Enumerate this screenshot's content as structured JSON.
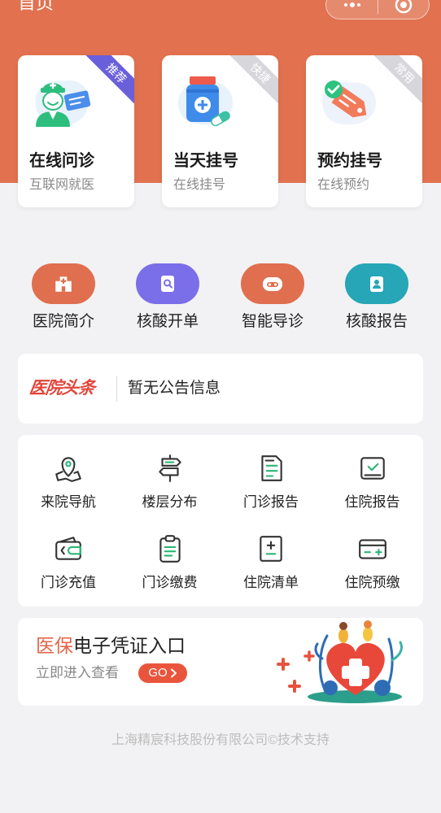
{
  "header": {
    "title": "首页",
    "background_color": "#E1714F",
    "capsule": {
      "more_icon": "more-dots-icon",
      "record_icon": "target-icon"
    }
  },
  "quick_cards": [
    {
      "title": "在线问诊",
      "subtitle": "互联网就医",
      "tag": "推荐",
      "tag_color": "#6A5FDB",
      "icon": "doctor-icon"
    },
    {
      "title": "当天挂号",
      "subtitle": "在线挂号",
      "tag": "快捷",
      "tag_color": "#D6D6DB",
      "icon": "medicine-bottle-icon"
    },
    {
      "title": "预约挂号",
      "subtitle": "在线预约",
      "tag": "常用",
      "tag_color": "#D6D6DB",
      "icon": "appointment-tag-icon"
    }
  ],
  "shortcuts": [
    {
      "label": "医院简介",
      "icon": "hospital-icon",
      "color": "#DF6F4E"
    },
    {
      "label": "核酸开单",
      "icon": "document-search-icon",
      "color": "#7A6EE9"
    },
    {
      "label": "智能导诊",
      "icon": "robot-icon",
      "color": "#DF6F4E"
    },
    {
      "label": "核酸报告",
      "icon": "report-badge-icon",
      "color": "#26A6B7"
    }
  ],
  "notice": {
    "logo": "医院头条",
    "message": "暂无公告信息"
  },
  "services": [
    {
      "label": "来院导航",
      "icon": "map-pin-icon"
    },
    {
      "label": "楼层分布",
      "icon": "signpost-icon"
    },
    {
      "label": "门诊报告",
      "icon": "document-icon"
    },
    {
      "label": "住院报告",
      "icon": "tray-check-icon"
    },
    {
      "label": "门诊充值",
      "icon": "wallet-icon"
    },
    {
      "label": "门诊缴费",
      "icon": "clipboard-icon"
    },
    {
      "label": "住院清单",
      "icon": "document-plus-icon"
    },
    {
      "label": "住院预缴",
      "icon": "card-icon"
    }
  ],
  "banner": {
    "highlight": "医保",
    "title": "电子凭证入口",
    "subtitle": "立即进入查看",
    "go_label": "GO",
    "highlight_color": "#E0664A",
    "button_color": "#E9553C"
  },
  "footer": {
    "text": "上海精宸科技股份有限公司©技术支持"
  }
}
